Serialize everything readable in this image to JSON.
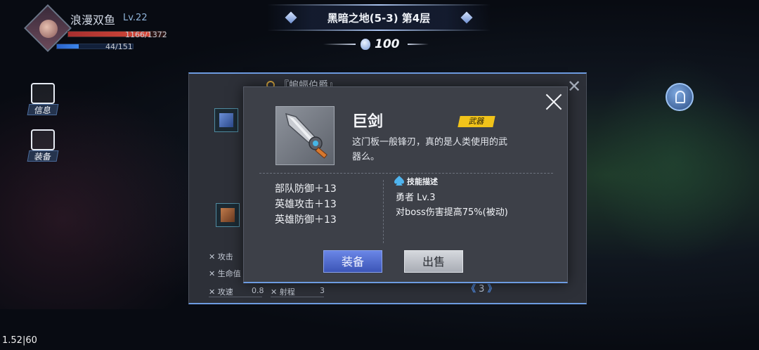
{
  "hud": {
    "player_name": "浪漫双鱼",
    "player_level": "Lv.22",
    "hp_text": "1166/1372",
    "hp_fraction": 0.85,
    "mp_text": "44/151",
    "mp_fraction": 0.29
  },
  "banner": {
    "title": "黑暗之地(5-3) 第4层",
    "currency_value": "100",
    "currency_icon": "crystal-icon"
  },
  "side_menu": [
    {
      "label": "信息",
      "icon": "info-scroll-icon"
    },
    {
      "label": "装备",
      "icon": "equipment-chest-icon"
    }
  ],
  "back_panel": {
    "heading": "『蝙蝠伯爵』",
    "stats": [
      {
        "label": "攻击",
        "value": ""
      },
      {
        "label": "生命值",
        "value": ""
      },
      {
        "label": "攻速",
        "value": "0.8"
      },
      {
        "label": "射程",
        "value": "3"
      }
    ],
    "page": "3"
  },
  "item": {
    "name": "巨剑",
    "tag": "武器",
    "description": "这门板一般锋刃，真的是人类使用的武器么。",
    "stats": [
      "部队防御＋13",
      "英雄攻击＋13",
      "英雄防御＋13"
    ],
    "skill_title": "技能描述",
    "skill_lines": [
      "勇者 Lv.3",
      "对boss伤害提高75%(被动)"
    ],
    "equip_label": "装备",
    "sell_label": "出售"
  },
  "fps": "1.52|60",
  "colors": {
    "accent_blue": "#6d9be0",
    "tag_yellow": "#f1c31a",
    "hp_red": "#d54a3a",
    "mp_blue": "#3c86ec"
  }
}
